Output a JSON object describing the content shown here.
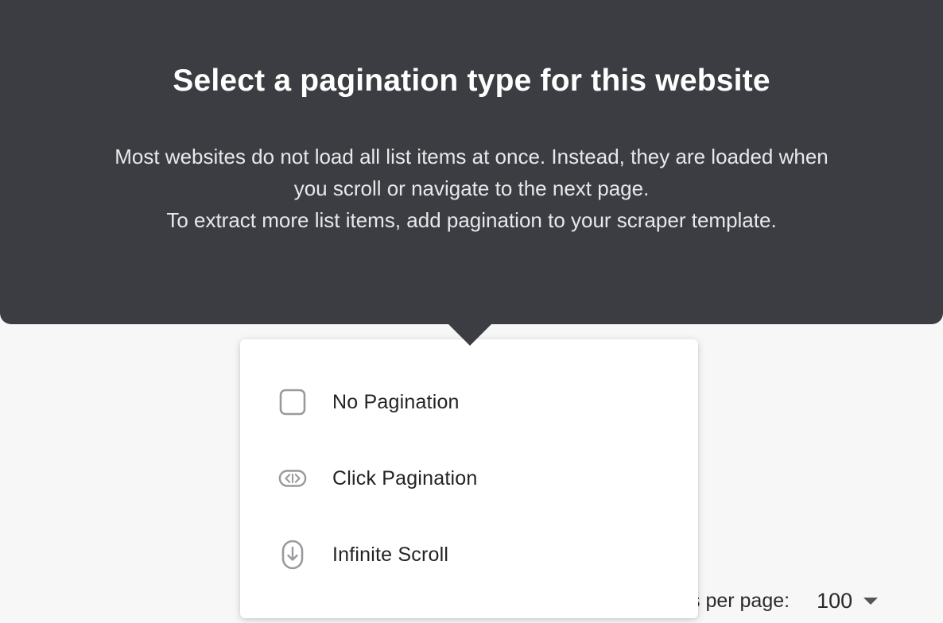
{
  "tooltip": {
    "title": "Select a pagination type for this website",
    "body_line_1": "Most websites do not load all list items at once. Instead, they are loaded when",
    "body_line_2": "you scroll or navigate to the next page.",
    "body_line_3": "To extract more list items, add pagination to your scraper template."
  },
  "menu": {
    "items": [
      {
        "label": "No Pagination",
        "icon": "checkbox-square-icon"
      },
      {
        "label": "Click Pagination",
        "icon": "arrows-left-right-icon"
      },
      {
        "label": "Infinite Scroll",
        "icon": "mouse-scroll-icon"
      }
    ]
  },
  "pagination_footer": {
    "rows_label": "s per page:",
    "rows_value": "100"
  },
  "colors": {
    "tooltip_bg": "#3c3d42",
    "menu_bg": "#ffffff",
    "page_bg": "#f7f7f8",
    "icon_gray": "#9a9a9e",
    "accent": "#e98a3a"
  }
}
